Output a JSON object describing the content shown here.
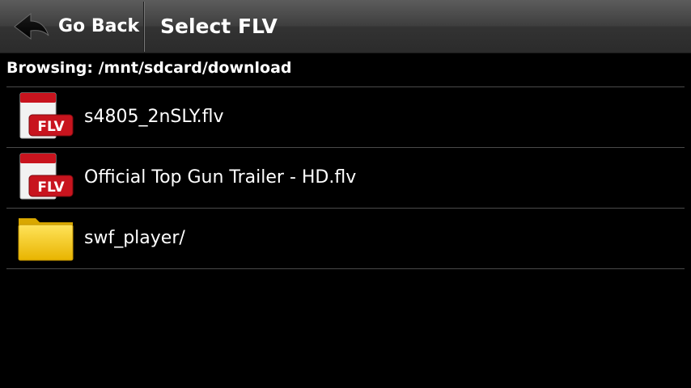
{
  "header": {
    "back_label": "Go Back",
    "title": "Select FLV"
  },
  "browsing": {
    "path_text": "Browsing: /mnt/sdcard/download"
  },
  "files": [
    {
      "name": "s4805_2nSLY.flv",
      "type": "flv",
      "icon": "flv-file-icon",
      "icon_text": "FLV"
    },
    {
      "name": "Official Top Gun Trailer - HD.flv",
      "type": "flv",
      "icon": "flv-file-icon",
      "icon_text": "FLV"
    },
    {
      "name": "swf_player/",
      "type": "folder",
      "icon": "folder-icon"
    }
  ],
  "colors": {
    "background": "#000000",
    "flv_red": "#c8141e",
    "folder_yellow": "#f4c81a"
  }
}
